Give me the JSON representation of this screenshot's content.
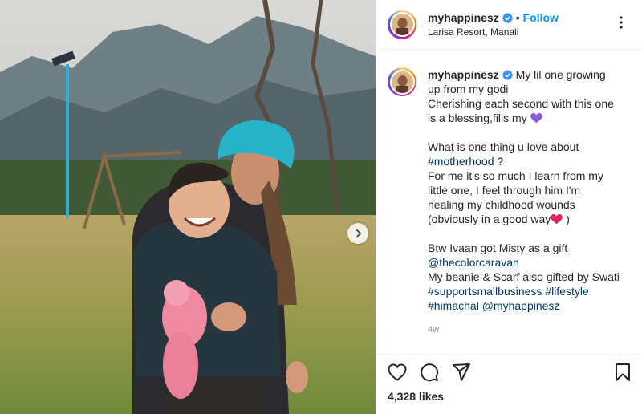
{
  "post": {
    "username": "myhappinesz",
    "separator": "•",
    "follow_label": "Follow",
    "location": "Larisa Resort, Manali",
    "more_label": "⋮",
    "caption": {
      "line1_text": " My lil one growing",
      "line2": "up from my godi",
      "line3": "Cherishing each second with this one",
      "line4_text": "is a blessing,fills my ",
      "line5": "What is one thing u love about",
      "hashtag_motherhood": "#motherhood",
      "line6_tail": " ?",
      "line7": "For me it's so much I learn from my",
      "line8": "little one, I feel through him I'm",
      "line9": "healing my childhood wounds",
      "line10_text": "(obviously in a good way",
      "line10_tail": " )",
      "line11": "Btw Ivaan got Misty as a gift",
      "mention_colorcaravan": "@thecolorcaravan",
      "line13": "My beanie & Scarf also gifted by Swati",
      "hashtag_supportsmallbusiness": "#supportsmallbusiness",
      "hashtag_lifestyle": "#lifestyle",
      "hashtag_himachal": "#himachal",
      "mention_myhappinesz": "@myhappinesz"
    },
    "posted_ago": "4w",
    "likes": "4,328 likes",
    "colors": {
      "link": "#00376b",
      "follow": "#0095f6",
      "verified": "#3897f0",
      "heart_purple": "#8a5cd6",
      "heart_red": "#e0245e"
    },
    "icons": [
      "verified-badge-icon",
      "more-options-icon",
      "like-icon",
      "comment-icon",
      "share-icon",
      "save-icon",
      "carousel-next-icon"
    ]
  }
}
